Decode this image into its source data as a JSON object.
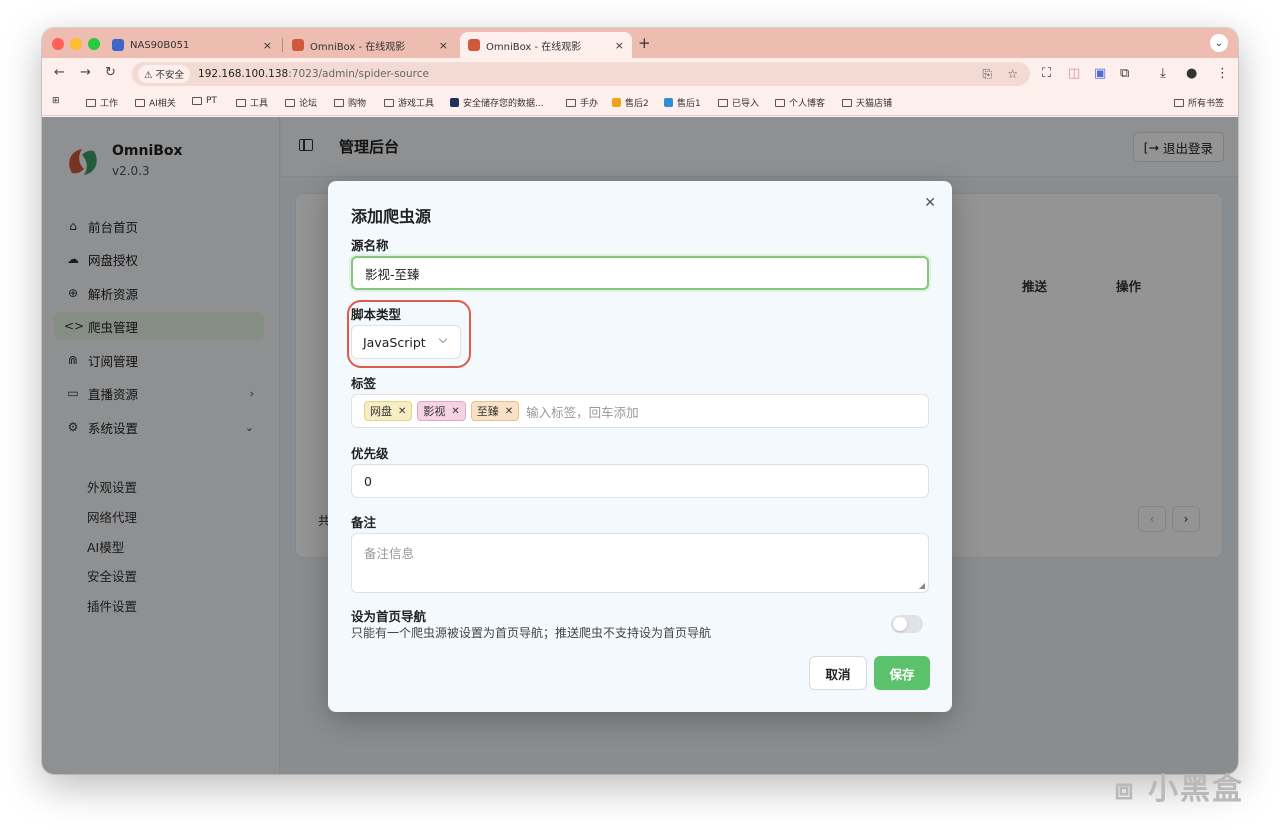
{
  "browser": {
    "tabs": [
      {
        "title": "NAS90B051",
        "favicon_color": "#3a67c9"
      },
      {
        "title": "OmniBox - 在线观影",
        "favicon_color": "#d0593d"
      },
      {
        "title": "OmniBox - 在线观影",
        "favicon_color": "#d0593d"
      }
    ],
    "close_glyph": "×",
    "new_tab_glyph": "+",
    "address": {
      "security_label": "⚠ 不安全",
      "host": "192.168.100.138",
      "path": ":7023/admin/spider-source"
    },
    "bookmarks": [
      "工作",
      "AI相关",
      "PT",
      "工具",
      "论坛",
      "购物",
      "游戏工具",
      "安全储存您的数据...",
      "手办",
      "售后2",
      "售后1",
      "已导入",
      "个人博客",
      "天猫店铺"
    ],
    "all_bookmarks": "所有书签"
  },
  "app": {
    "name": "OmniBox",
    "version": "v2.0.3",
    "page_title": "管理后台",
    "logout_label": "退出登录",
    "nav": [
      {
        "label": "前台首页",
        "icon": "home-icon",
        "glyph": "⌂"
      },
      {
        "label": "网盘授权",
        "icon": "cloud-icon",
        "glyph": "☁"
      },
      {
        "label": "解析资源",
        "icon": "globe-icon",
        "glyph": "⊕"
      },
      {
        "label": "爬虫管理",
        "icon": "code-icon",
        "glyph": "<>"
      },
      {
        "label": "订阅管理",
        "icon": "rss-icon",
        "glyph": "⋒"
      },
      {
        "label": "直播资源",
        "icon": "tv-icon",
        "glyph": "▭"
      },
      {
        "label": "系统设置",
        "icon": "gear-icon",
        "glyph": "⚙"
      }
    ],
    "sub_nav": [
      "外观设置",
      "网络代理",
      "AI模型",
      "安全设置",
      "插件设置"
    ],
    "table_headers": [
      "推送",
      "操作"
    ],
    "total_prefix": "共"
  },
  "modal": {
    "title": "添加爬虫源",
    "name_label": "源名称",
    "name_value": "影视-至臻",
    "type_label": "脚本类型",
    "type_value": "JavaScript",
    "tags_label": "标签",
    "tags": [
      "网盘",
      "影视",
      "至臻"
    ],
    "tags_placeholder": "输入标签，回车添加",
    "priority_label": "优先级",
    "priority_value": "0",
    "remark_label": "备注",
    "remark_placeholder": "备注信息",
    "home_nav_label": "设为首页导航",
    "home_nav_desc": "只能有一个爬虫源被设置为首页导航；推送爬虫不支持设为首页导航",
    "home_nav_enabled": false,
    "cancel_label": "取消",
    "save_label": "保存",
    "accent_color": "#5cc26b",
    "highlight_color": "#e05a4a"
  },
  "watermark": "小黑盒"
}
